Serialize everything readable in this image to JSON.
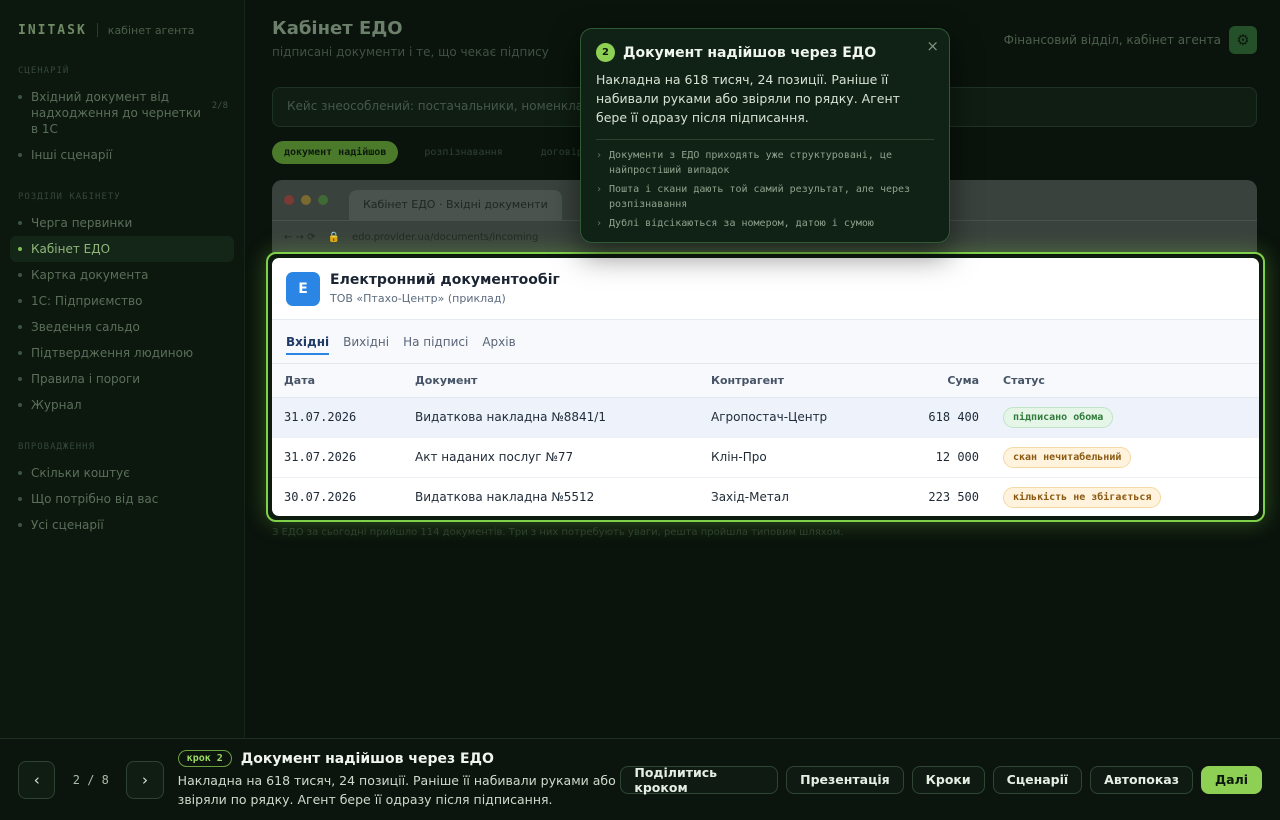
{
  "sidebar": {
    "brand": "INITASK",
    "brand_sub": "кабінет агента",
    "section_scenario": "СЦЕНАРІЙ",
    "scenario_items": [
      {
        "label": "Вхідний документ від надходження до чернетки в 1С",
        "count": "2/8"
      },
      {
        "label": "Інші сценарії"
      }
    ],
    "section_views": "РОЗДІЛИ КАБІНЕТУ",
    "view_items": [
      {
        "label": "Черга первинки"
      },
      {
        "label": "Кабінет ЕДО"
      },
      {
        "label": "Картка документа"
      },
      {
        "label": "1С: Підприємство"
      },
      {
        "label": "Зведення сальдо"
      },
      {
        "label": "Підтвердження людиною"
      },
      {
        "label": "Правила і пороги"
      },
      {
        "label": "Журнал"
      }
    ],
    "section_launch": "ВПРОВАДЖЕННЯ",
    "launch_items": [
      {
        "label": "Скільки коштує"
      },
      {
        "label": "Що потрібно від вас"
      },
      {
        "label": "Усі сценарії"
      }
    ]
  },
  "main": {
    "title": "Кабінет ЕДО",
    "subtitle": "підписані документи і те, що чекає підпису",
    "context": "Фінансовий відділ, кабінет агента",
    "case_text": "Кейс знеособлений: постачальники, номенклатура",
    "step_tabs": [
      "документ надійшов",
      "розпізнавання",
      "договір"
    ],
    "footnote": "З ЕДО за сьогодні прийшло 114 документів. Три з них потребують уваги, решта пройшла типовим шляхом."
  },
  "browser": {
    "tab_title": "Кабінет ЕДО · Вхідні документи",
    "nav_glyphs": "← → ⟳",
    "url": "edo.provider.ua/documents/incoming"
  },
  "edo": {
    "logo_letter": "E",
    "title": "Електронний документообіг",
    "org": "ТОВ «Птахо-Центр» (приклад)",
    "tabs": [
      "Вхідні",
      "Вихідні",
      "На підписі",
      "Архів"
    ],
    "columns": {
      "date": "Дата",
      "doc": "Документ",
      "party": "Контрагент",
      "sum": "Сума",
      "status": "Статус"
    },
    "rows": [
      {
        "date": "31.07.2026",
        "doc": "Видаткова накладна №8841/1",
        "party": "Агропостач-Центр",
        "sum": "618 400",
        "status": "підписано обома"
      },
      {
        "date": "31.07.2026",
        "doc": "Акт наданих послуг №77",
        "party": "Клін-Про",
        "sum": "12 000",
        "status": "скан нечитабельний"
      },
      {
        "date": "30.07.2026",
        "doc": "Видаткова накладна №5512",
        "party": "Захід-Метал",
        "sum": "223 500",
        "status": "кількість не збігається"
      }
    ]
  },
  "tooltip": {
    "num": "2",
    "title": "Документ надійшов через ЕДО",
    "close": "×",
    "body": "Накладна на 618 тисяч, 24 позиції. Раніше її набивали руками або звіряли по рядку. Агент бере її одразу після підписання.",
    "bullets": [
      "Документи з ЕДО приходять уже структуровані, це найпростіший випадок",
      "Пошта і скани дають той самий результат, але через розпізнавання",
      "Дублі відсікаються за номером, датою і сумою"
    ]
  },
  "tourbar": {
    "prev": "‹",
    "next": "›",
    "counter": "2 / 8",
    "step_badge": "крок 2",
    "title": "Документ надійшов через ЕДО",
    "desc": "Накладна на 618 тисяч, 24 позиції. Раніше її набивали руками або звіряли по рядку. Агент бере її одразу після підписання.",
    "actions": {
      "share": "Поділитись кроком",
      "presentation": "Презентація",
      "steps": "Кроки",
      "scenarios": "Сценарії",
      "autoplay": "Автопоказ",
      "next": "Далі"
    }
  },
  "colors": {
    "accent": "#8ed053",
    "highlight_border": "#7fd14a",
    "edo_blue": "#2b85e4"
  }
}
